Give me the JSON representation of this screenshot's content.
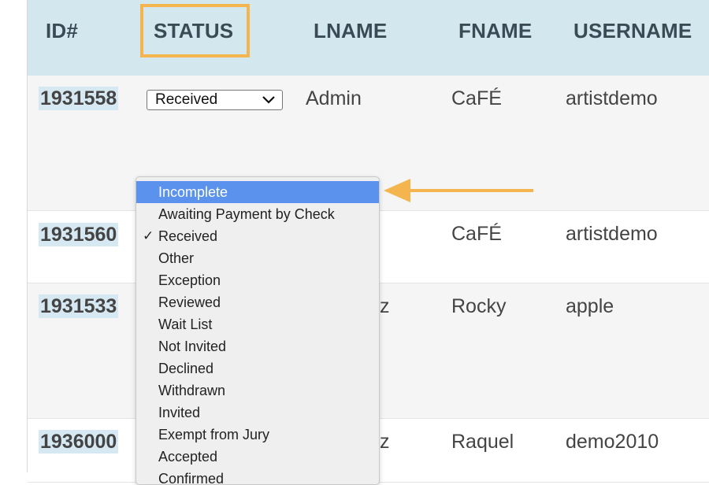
{
  "columns": {
    "id": "ID#",
    "status": "STATUS",
    "lname": "LNAME",
    "fname": "FNAME",
    "username": "USERNAME"
  },
  "rows": [
    {
      "id": "1931558",
      "status": "Received",
      "lname": "Admin",
      "fname": "CaFÉ",
      "username": "artistdemo"
    },
    {
      "id": "1931560",
      "status": "",
      "lname": "",
      "fname": "CaFÉ",
      "username": "artistdemo"
    },
    {
      "id": "1931533",
      "status": "",
      "lname": "z",
      "fname": "Rocky",
      "username": "apple"
    },
    {
      "id": "1936000",
      "status": "",
      "lname": "z",
      "fname": "Raquel",
      "username": "demo2010"
    }
  ],
  "status_dropdown": {
    "selected_value": "Received",
    "highlighted": "Incomplete",
    "checked": "Received",
    "options": [
      "Incomplete",
      "Awaiting Payment by Check",
      "Received",
      "Other",
      "Exception",
      "Reviewed",
      "Wait List",
      "Not Invited",
      "Declined",
      "Withdrawn",
      "Invited",
      "Exempt from Jury",
      "Accepted",
      "Confirmed"
    ]
  },
  "colors": {
    "header_bg": "#d2e7ee",
    "highlight_border": "#f4b54f",
    "arrow": "#f4b54f",
    "selected_option": "#5a92ee",
    "id_bg": "#d6e9f2"
  }
}
